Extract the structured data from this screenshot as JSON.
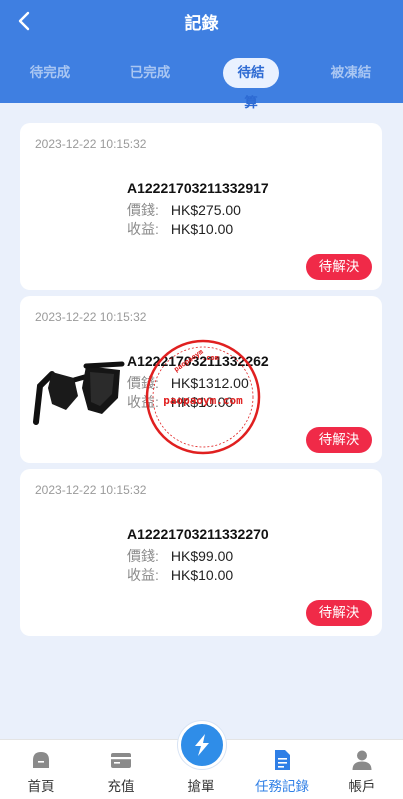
{
  "header": {
    "title": "記錄"
  },
  "tabs": [
    {
      "label": "待完成"
    },
    {
      "label": "已完成"
    },
    {
      "label": "待結算"
    },
    {
      "label": "被凍結"
    }
  ],
  "records": [
    {
      "time": "2023-12-22 10:15:32",
      "order_id": "A12221703211332917",
      "price_label": "價錢:",
      "price": "HK$275.00",
      "income_label": "收益:",
      "income": "HK$10.00",
      "status": "待解決"
    },
    {
      "time": "2023-12-22 10:15:32",
      "order_id": "A12221703211332262",
      "price_label": "價錢:",
      "price": "HK$1312.00",
      "income_label": "收益:",
      "income": "HK$10.00",
      "status": "待解決",
      "image": "sunglasses"
    },
    {
      "time": "2023-12-22 10:15:32",
      "order_id": "A12221703211332270",
      "price_label": "價錢:",
      "price": "HK$99.00",
      "income_label": "收益:",
      "income": "HK$10.00",
      "status": "待解決"
    }
  ],
  "watermark": {
    "text": "paopaoym.com"
  },
  "tabbar": {
    "items": [
      {
        "label": "首頁",
        "icon": "home-icon"
      },
      {
        "label": "充值",
        "icon": "card-icon"
      },
      {
        "label": "搶單",
        "icon": "lightning-icon"
      },
      {
        "label": "任務記錄",
        "icon": "document-icon"
      },
      {
        "label": "帳戶",
        "icon": "user-icon"
      }
    ]
  },
  "colors": {
    "primary": "#3f7fe1",
    "status": "#f02a48",
    "active_tab": "#2f7fe6",
    "background": "#eaf0fb"
  }
}
